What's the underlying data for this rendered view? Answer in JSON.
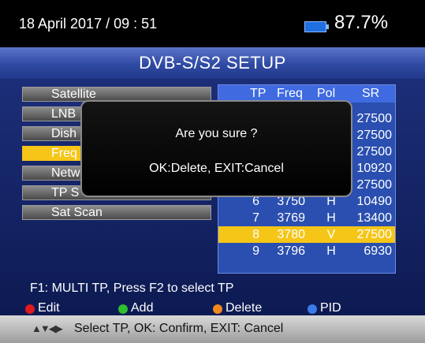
{
  "status": {
    "datetime": "18 April 2017 / 09 : 51",
    "battery": "87.7%",
    "battery_icon": "battery-icon"
  },
  "title": "DVB-S/S2 SETUP",
  "menu": [
    {
      "label": "Satellite"
    },
    {
      "label": "LNB"
    },
    {
      "label": "Dish"
    },
    {
      "label": "Freq"
    },
    {
      "label": "Netw"
    },
    {
      "label": "TP S"
    },
    {
      "label": "Sat Scan"
    }
  ],
  "table": {
    "headers": {
      "tp": "TP",
      "freq": "Freq",
      "pol": "Pol",
      "sr": "SR"
    },
    "rows": [
      {
        "tp": "",
        "freq": "",
        "pol": "",
        "sr": "27500"
      },
      {
        "tp": "",
        "freq": "",
        "pol": "",
        "sr": "27500"
      },
      {
        "tp": "",
        "freq": "",
        "pol": "",
        "sr": "27500"
      },
      {
        "tp": "",
        "freq": "",
        "pol": "",
        "sr": "10920"
      },
      {
        "tp": "",
        "freq": "",
        "pol": "",
        "sr": "27500"
      },
      {
        "tp": "6",
        "freq": "3750",
        "pol": "H",
        "sr": "10490"
      },
      {
        "tp": "7",
        "freq": "3769",
        "pol": "H",
        "sr": "13400"
      },
      {
        "tp": "8",
        "freq": "3780",
        "pol": "V",
        "sr": "27500"
      },
      {
        "tp": "9",
        "freq": "3796",
        "pol": "H",
        "sr": "6930"
      }
    ]
  },
  "dialog": {
    "question": "Are you sure ?",
    "actions": "OK:Delete, EXIT:Cancel"
  },
  "hint": "F1: MULTI TP, Press F2 to select TP",
  "keys": {
    "edit": "Edit",
    "add": "Add",
    "delete": "Delete",
    "pid": "PID",
    "colors": {
      "red": "#e0191f",
      "green": "#2fbf2f",
      "orange": "#f08a1d",
      "blue": "#3a7be8"
    }
  },
  "footer": "Select TP, OK: Confirm, EXIT: Cancel",
  "colors": {
    "accent": "#f5c518",
    "title_bar": "#2f4aa3",
    "panel": "#2a4fb0"
  }
}
